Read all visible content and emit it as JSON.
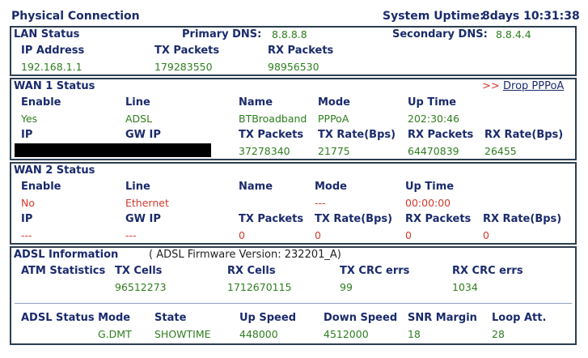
{
  "page": {
    "title": "Physical Connection",
    "uptime_label": "System Uptime:",
    "uptime_value": "8days 10:31:38"
  },
  "lan": {
    "title": "LAN Status",
    "primary_dns_label": "Primary DNS:",
    "primary_dns": "8.8.8.8",
    "secondary_dns_label": "Secondary DNS:",
    "secondary_dns": "8.8.4.4",
    "headers": [
      "IP Address",
      "TX Packets",
      "RX Packets"
    ],
    "values": [
      "192.168.1.1",
      "179283550",
      "98956530"
    ]
  },
  "wan1": {
    "title": "WAN 1 Status",
    "drop_prefix": ">>",
    "drop_link": "Drop PPPoA",
    "row1_headers": [
      "Enable",
      "Line",
      "Name",
      "Mode",
      "Up Time"
    ],
    "row1_values": [
      "Yes",
      "ADSL",
      "BTBroadband",
      "PPPoA",
      "202:30:46"
    ],
    "row2_headers": [
      "IP",
      "GW IP",
      "TX Packets",
      "TX Rate(Bps)",
      "RX Packets",
      "RX Rate(Bps)"
    ],
    "row2_values": [
      "",
      "",
      "37278340",
      "21775",
      "64470839",
      "26455"
    ]
  },
  "wan2": {
    "title": "WAN 2 Status",
    "row1_headers": [
      "Enable",
      "Line",
      "Name",
      "Mode",
      "Up Time"
    ],
    "row1_values": [
      "No",
      "Ethernet",
      "",
      "---",
      "00:00:00"
    ],
    "row2_headers": [
      "IP",
      "GW IP",
      "TX Packets",
      "TX Rate(Bps)",
      "RX Packets",
      "RX Rate(Bps)"
    ],
    "row2_values": [
      "---",
      "---",
      "0",
      "0",
      "0",
      "0"
    ]
  },
  "adsl": {
    "title": "ADSL Information",
    "firmware_text": "( ADSL Firmware Version:  232201_A)",
    "atm_label": "ATM Statistics",
    "atm_headers": [
      "TX Cells",
      "RX Cells",
      "TX CRC errs",
      "RX CRC errs"
    ],
    "atm_values": [
      "96512273",
      "1712670115",
      "99",
      "1034"
    ],
    "status_headers": [
      "ADSL Status Mode",
      "State",
      "Up Speed",
      "Down Speed",
      "SNR Margin",
      "Loop Att."
    ],
    "status_values": [
      "G.DMT",
      "SHOWTIME",
      "448000",
      "4512000",
      "18",
      "28"
    ]
  },
  "colors": {
    "heading": "#1a2a6c",
    "value_green": "#2e7d1e",
    "value_red": "#d33a2c",
    "border": "#2c3e50"
  }
}
